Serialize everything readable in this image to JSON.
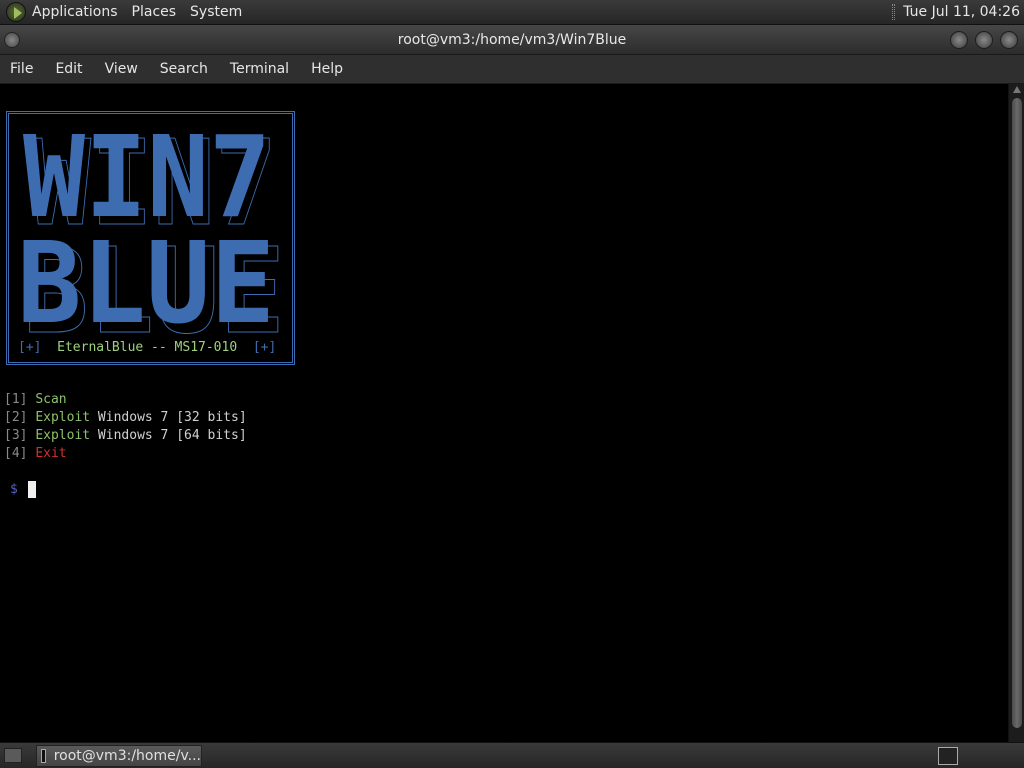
{
  "top_panel": {
    "menus": [
      "Applications",
      "Places",
      "System"
    ],
    "clock": "Tue Jul 11, 04:26"
  },
  "window": {
    "title": "root@vm3:/home/vm3/Win7Blue"
  },
  "terminal_menu": [
    "File",
    "Edit",
    "View",
    "Search",
    "Terminal",
    "Help"
  ],
  "banner": {
    "ascii_lines": [
      "WIN7",
      "BLUE"
    ],
    "caption_left_bracket": "[+]",
    "caption_text": "EternalBlue -- MS17-010",
    "caption_right_bracket": "[+]"
  },
  "options": [
    {
      "num": "[1]",
      "action": "Scan",
      "rest": ""
    },
    {
      "num": "[2]",
      "action": "Exploit",
      "rest": " Windows 7 [32 bits]"
    },
    {
      "num": "[3]",
      "action": "Exploit",
      "rest": " Windows 7 [64 bits]"
    },
    {
      "num": "[4]",
      "action": "Exit",
      "rest": ""
    }
  ],
  "prompt": "$",
  "taskbar": {
    "item_label": "root@vm3:/home/v..."
  },
  "colors": {
    "banner_blue": "#3d6cb0",
    "option_green": "#8ec16a",
    "exit_red": "#d03030"
  }
}
